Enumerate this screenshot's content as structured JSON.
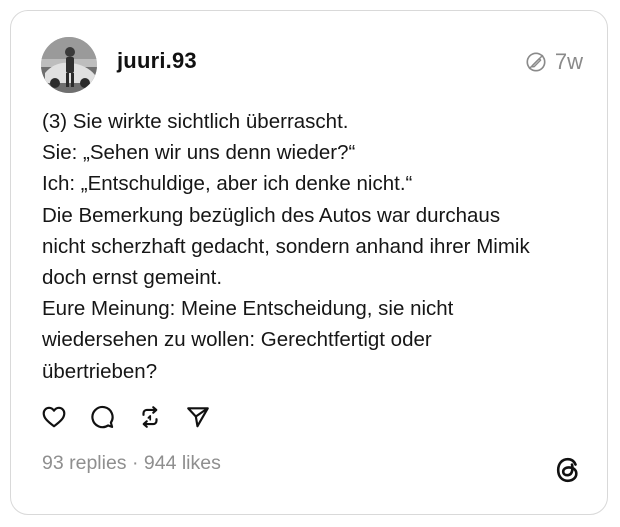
{
  "post": {
    "username": "juuri.93",
    "timestamp": "7w",
    "text_lines": [
      "(3) Sie wirkte sichtlich überrascht.",
      "Sie: „Sehen wir uns denn wieder?“",
      "Ich: „Entschuldige, aber ich denke nicht.“",
      "Die Bemerkung bezüglich des Autos war durchaus",
      "nicht scherzhaft gedacht, sondern anhand ihrer Mimik",
      "doch ernst gemeint.",
      "Eure Meinung: Meine Entscheidung, sie nicht",
      "wiedersehen zu wollen: Gerechtfertigt oder",
      "übertrieben?"
    ],
    "stats": "93 replies · 944 likes"
  },
  "icons": {
    "timestamp": "pencil-slash-icon",
    "like": "heart-icon",
    "reply": "comment-icon",
    "repost": "repost-icon",
    "share": "send-icon",
    "brand": "threads-logo-icon"
  },
  "colors": {
    "text": "#111111",
    "muted": "#8a8a8a",
    "border": "#d9d9d9",
    "background": "#ffffff"
  }
}
